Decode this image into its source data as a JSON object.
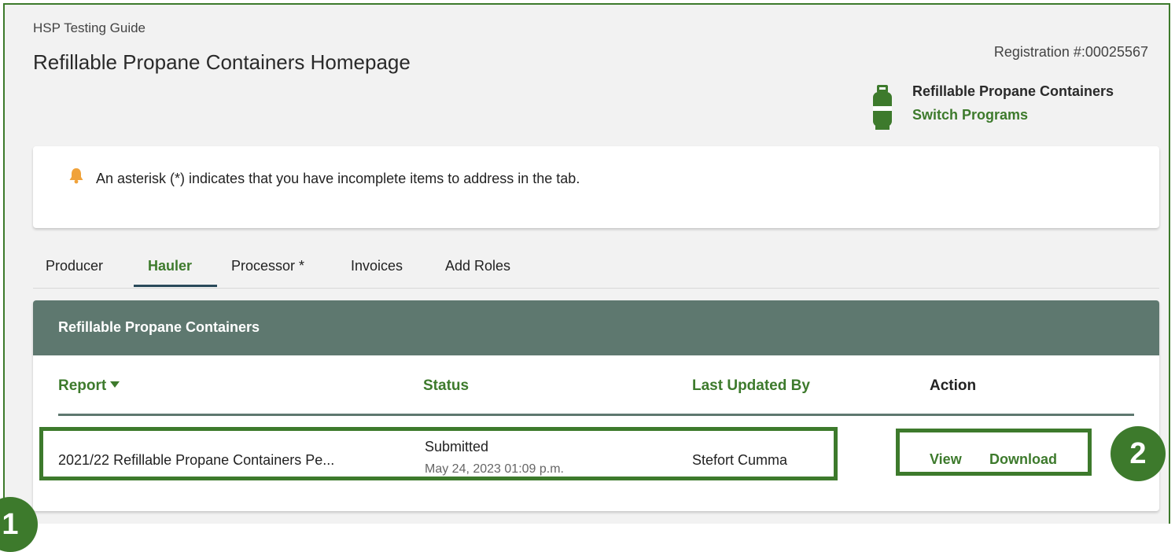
{
  "header": {
    "eyebrow": "HSP Testing Guide",
    "title": "Refillable Propane Containers Homepage",
    "registration": "Registration #:00025567",
    "program_name": "Refillable Propane Containers",
    "switch_label": "Switch Programs",
    "program_icon": "propane-tank-icon"
  },
  "notice": {
    "icon": "bell-icon",
    "text": "An asterisk (*) indicates that you have incomplete items to address in the tab."
  },
  "tabs": [
    {
      "label": "Producer"
    },
    {
      "label": "Hauler"
    },
    {
      "label": "Processor *"
    },
    {
      "label": "Invoices"
    },
    {
      "label": "Add Roles"
    }
  ],
  "active_tab": "Hauler",
  "card": {
    "title": "Refillable Propane Containers",
    "columns": {
      "report": "Report",
      "status": "Status",
      "updated_by": "Last Updated By",
      "action": "Action"
    },
    "rows": [
      {
        "report": "2021/22 Refillable Propane Containers Pe...",
        "status": "Submitted",
        "status_date": "May 24, 2023 01:09 p.m.",
        "updated_by": "Stefort Cumma",
        "actions": {
          "view": "View",
          "download": "Download"
        }
      }
    ]
  },
  "callouts": {
    "one": "1",
    "two": "2"
  },
  "colors": {
    "brand_green": "#3d7a2c",
    "header_gray_green": "#5e786f",
    "bell": "#f0a23a"
  }
}
